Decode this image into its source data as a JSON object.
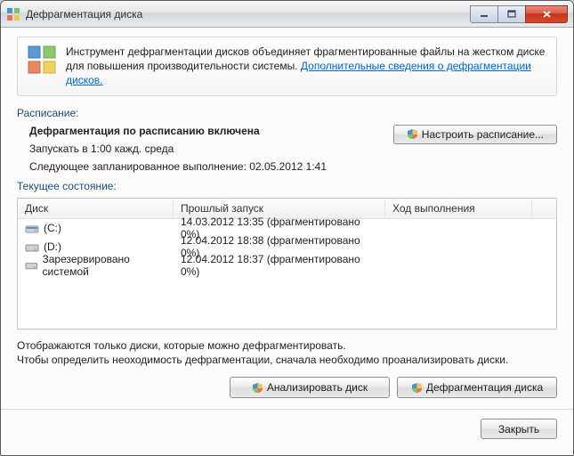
{
  "window": {
    "title": "Дефрагментация диска"
  },
  "info": {
    "text_prefix": "Инструмент дефрагментации дисков объединяет фрагментированные файлы на жестком диске для повышения производительности системы. ",
    "link_text": "Дополнительные сведения о дефрагментации дисков."
  },
  "schedule": {
    "section_label": "Расписание:",
    "title": "Дефрагментация по расписанию включена",
    "run_at": "Запускать в 1:00 кажд. среда",
    "next_run": "Следующее запланированное выполнение: 02.05.2012 1:41",
    "configure_button": "Настроить расписание..."
  },
  "status": {
    "section_label": "Текущее состояние:"
  },
  "table": {
    "headers": {
      "disk": "Диск",
      "last_run": "Прошлый запуск",
      "progress": "Ход выполнения"
    },
    "rows": [
      {
        "name": "(C:)",
        "icon": "drive-c",
        "last_run": "14.03.2012 13:35 (фрагментировано 0%)"
      },
      {
        "name": "(D:)",
        "icon": "drive-d",
        "last_run": "12.04.2012 18:38 (фрагментировано 0%)"
      },
      {
        "name": "Зарезервировано системой",
        "icon": "drive-sys",
        "last_run": "12.04.2012 18:37 (фрагментировано 0%)"
      }
    ]
  },
  "hint": {
    "line1": "Отображаются только диски, которые можно дефрагментировать.",
    "line2": "Чтобы определить неоходимость  дефрагментации, сначала необходимо проанализировать диски."
  },
  "buttons": {
    "analyze": "Анализировать диск",
    "defrag": "Дефрагментация диска",
    "close": "Закрыть"
  }
}
